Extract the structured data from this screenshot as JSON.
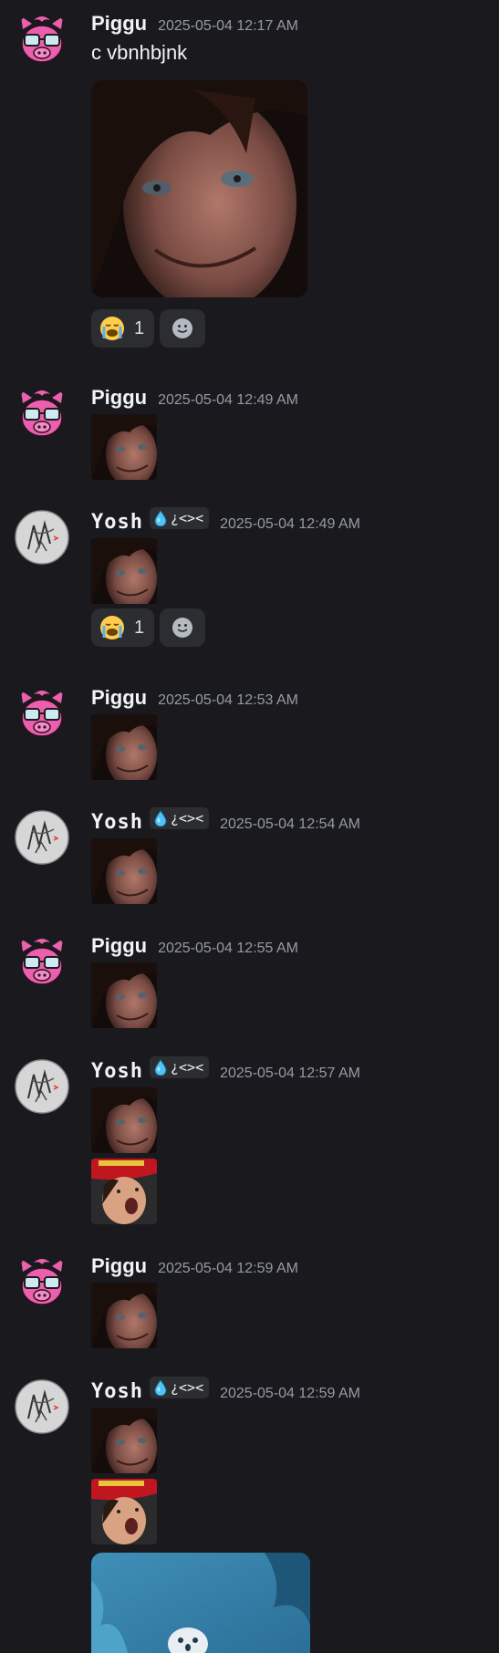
{
  "messages": [
    {
      "author": "Piggu",
      "time": "2025-05-04 12:17 AM",
      "text": "c vbnhbjnk"
    },
    {
      "author": "Piggu",
      "time": "2025-05-04 12:49 AM"
    },
    {
      "author": "Yosh",
      "tag": "¿<><",
      "time": "2025-05-04 12:49 AM"
    },
    {
      "author": "Piggu",
      "time": "2025-05-04 12:53 AM"
    },
    {
      "author": "Yosh",
      "tag": "¿<><",
      "time": "2025-05-04 12:54 AM"
    },
    {
      "author": "Piggu",
      "time": "2025-05-04 12:55 AM"
    },
    {
      "author": "Yosh",
      "tag": "¿<><",
      "time": "2025-05-04 12:57 AM"
    },
    {
      "author": "Piggu",
      "time": "2025-05-04 12:59 AM"
    },
    {
      "author": "Yosh",
      "tag": "¿<><",
      "time": "2025-05-04 12:59 AM"
    }
  ],
  "reactions": [
    {
      "emoji": "sob-emoji",
      "count": "1"
    },
    {
      "emoji": "sob-emoji",
      "count": "1"
    }
  ],
  "colors": {
    "background": "#1a1a1e",
    "piggu_pink": "#ec5fae",
    "reaction_bg": "#2b2d31",
    "timestamp": "#949ba4"
  }
}
